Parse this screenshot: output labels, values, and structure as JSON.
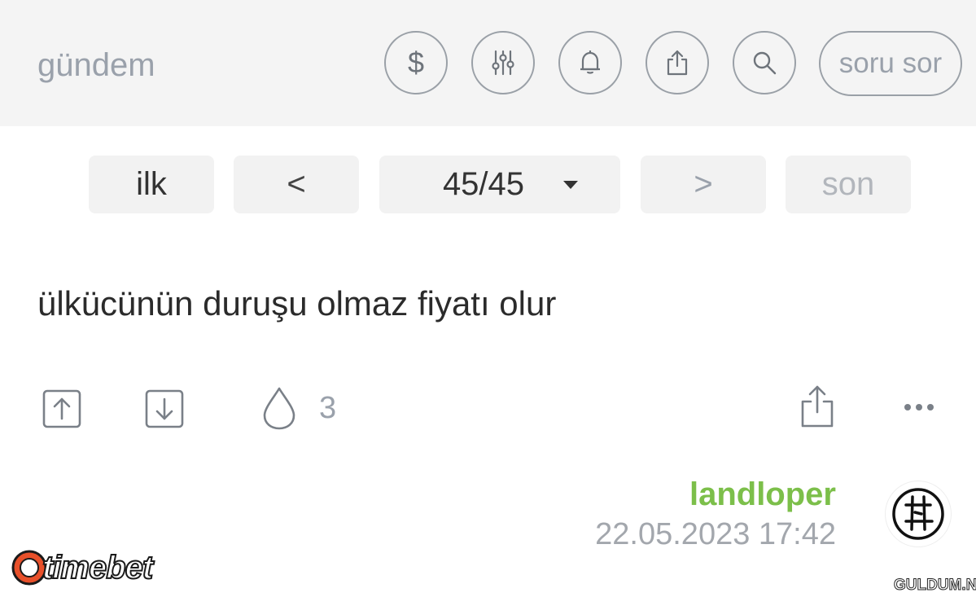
{
  "header": {
    "title": "gündem",
    "buttons": [
      {
        "name": "dollar-button",
        "icon": "dollar-icon"
      },
      {
        "name": "filter-button",
        "icon": "sliders-icon"
      },
      {
        "name": "notifications-button",
        "icon": "bell-icon"
      },
      {
        "name": "share-button",
        "icon": "share-icon"
      },
      {
        "name": "search-button",
        "icon": "search-icon"
      }
    ],
    "ask_label": "soru sor"
  },
  "pager": {
    "first_label": "ilk",
    "prev_label": "<",
    "page_label": "45/45",
    "next_label": ">",
    "last_label": "son"
  },
  "entry": {
    "text": "ülkücünün duruşu olmaz fiyatı olur",
    "favorite_count": "3",
    "author": "landloper",
    "timestamp": "22.05.2023 17:42"
  },
  "branding": {
    "logo_text": "timebet",
    "watermark": "GULDUM.NET"
  },
  "colors": {
    "author": "#7cbf4a",
    "logo_accent": "#e8502a"
  }
}
